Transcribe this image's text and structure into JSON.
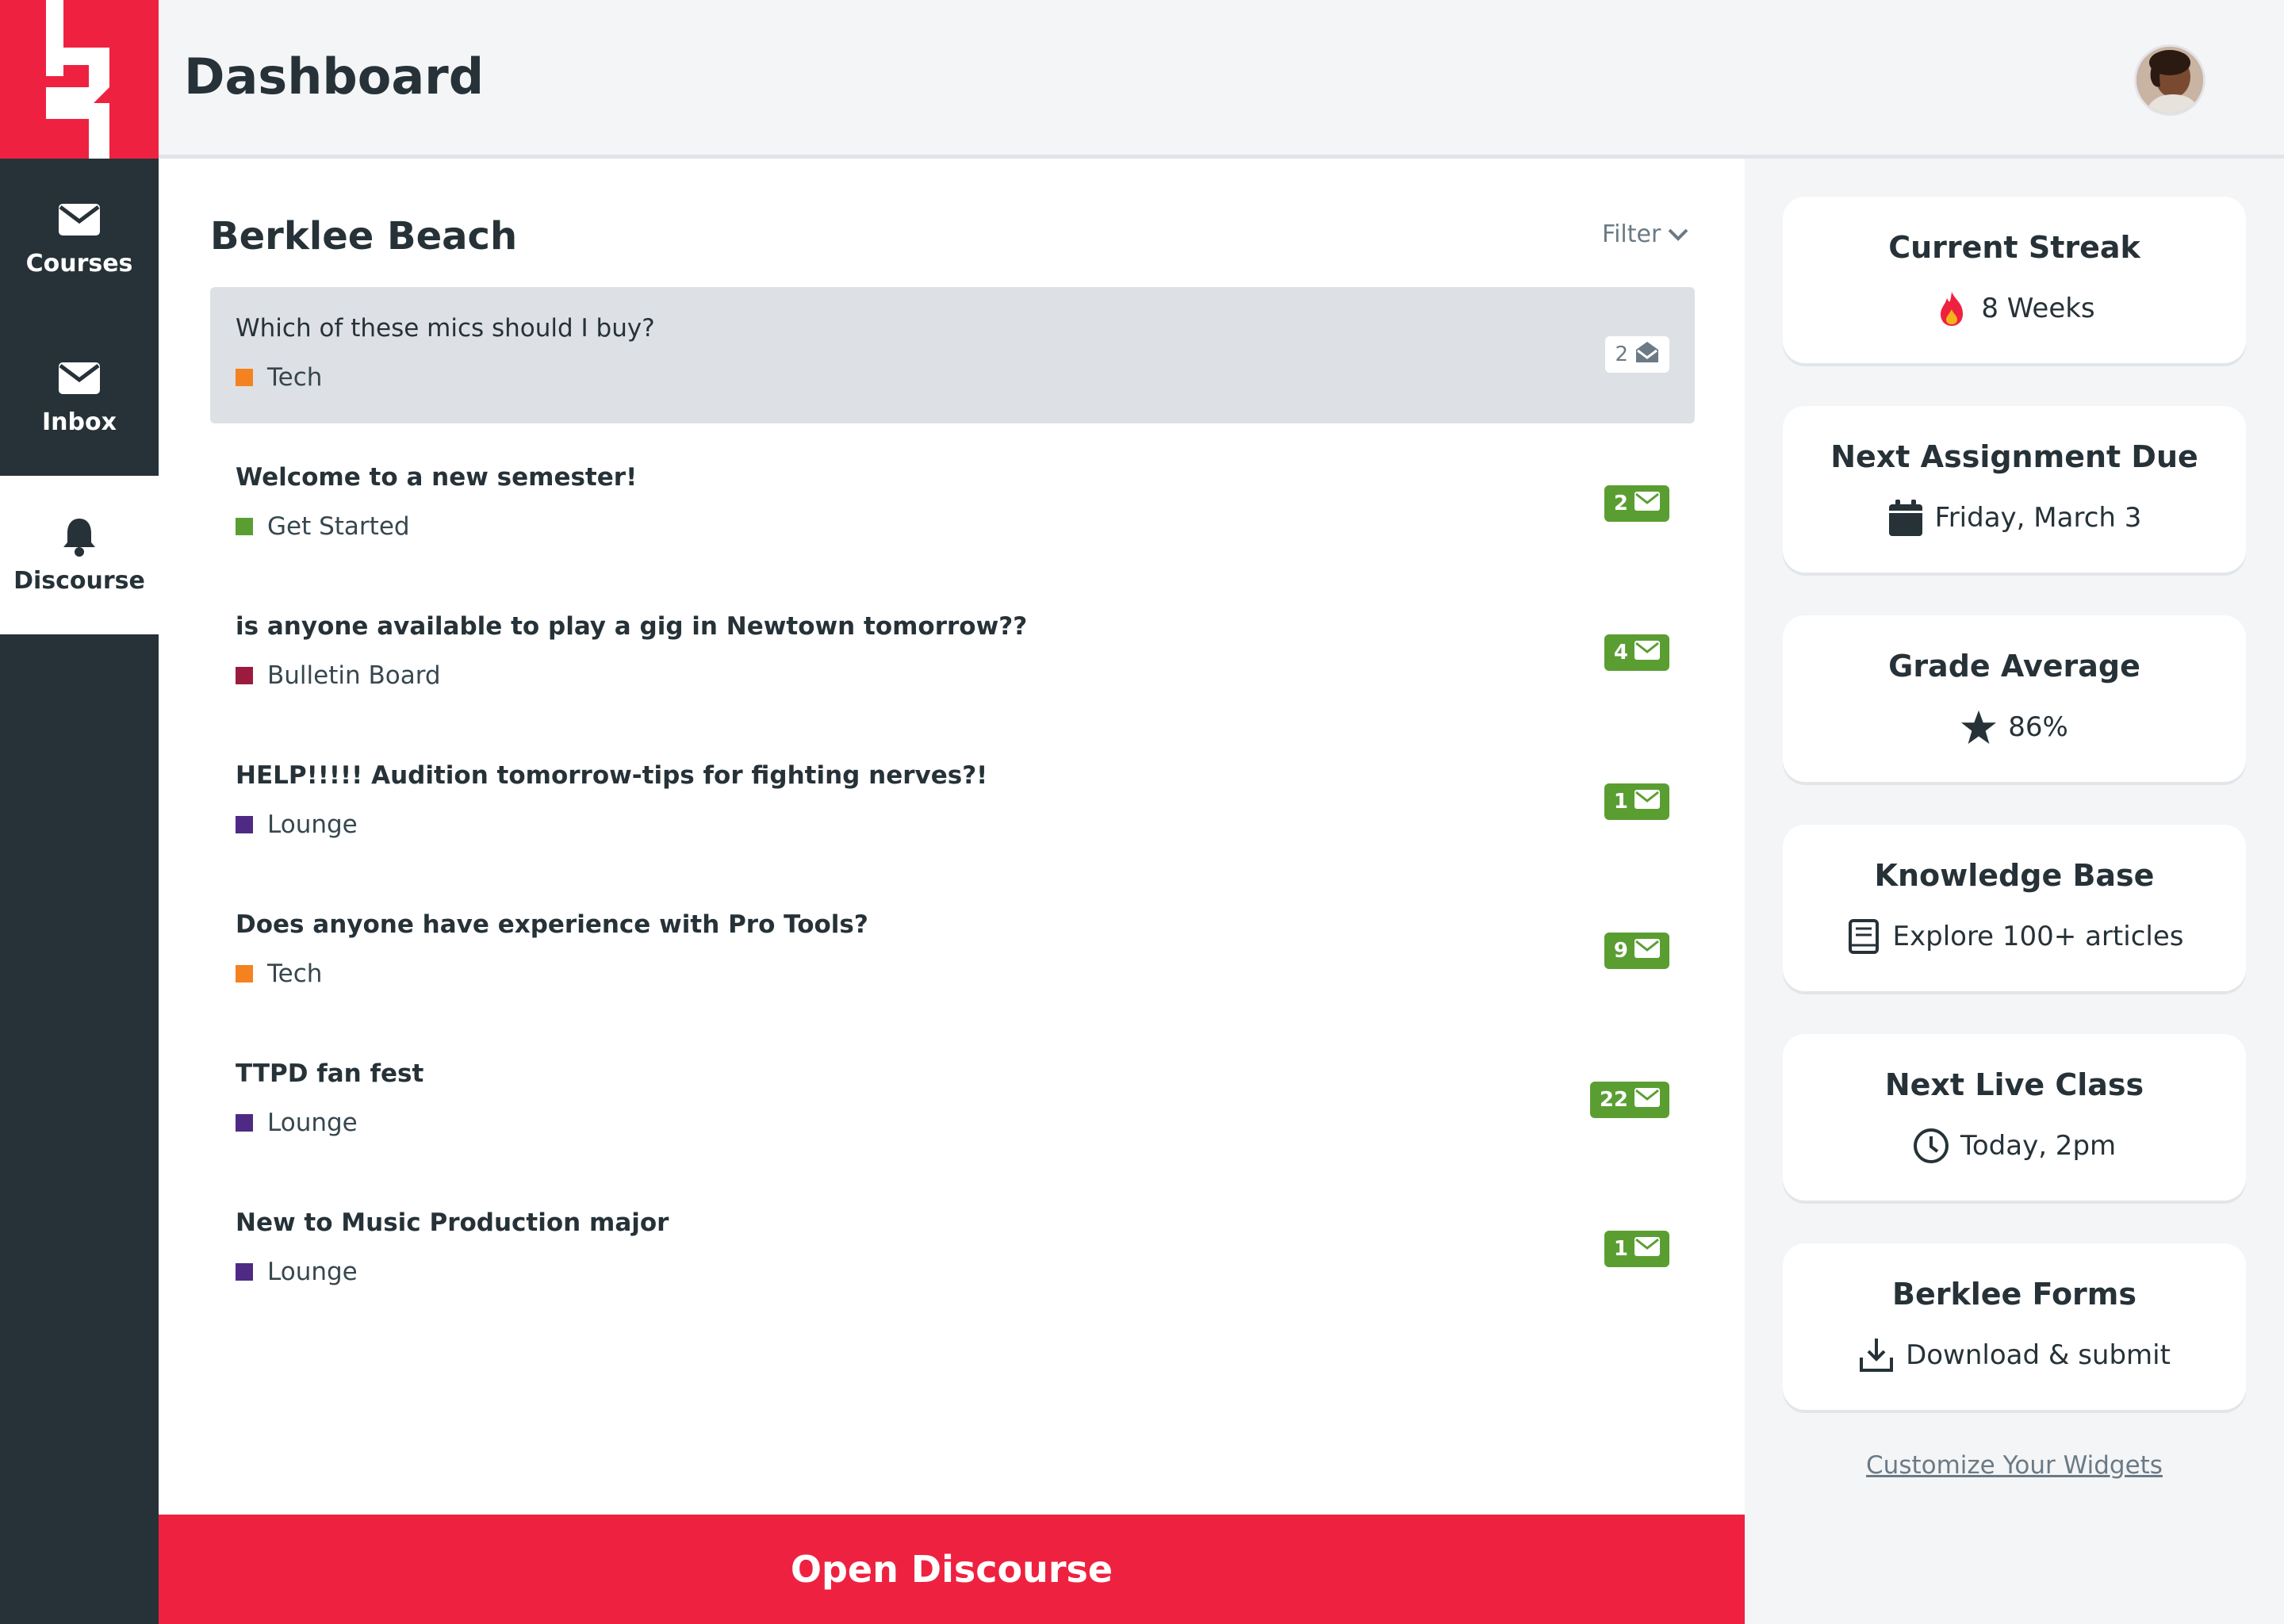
{
  "sidebar": {
    "items": [
      {
        "label": "Courses",
        "icon": "envelope-icon"
      },
      {
        "label": "Inbox",
        "icon": "envelope-icon"
      },
      {
        "label": "Discourse",
        "icon": "bell-icon",
        "active": true
      }
    ]
  },
  "header": {
    "title": "Dashboard"
  },
  "main": {
    "section_title": "Berklee Beach",
    "filter_label": "Filter",
    "topics": [
      {
        "title": "Which of these mics should I buy?",
        "category": "Tech",
        "category_color": "#f58220",
        "replies": "2",
        "read": true
      },
      {
        "title": "Welcome to a new semester!",
        "category": "Get Started",
        "category_color": "#5a9e32",
        "replies": "2",
        "read": false
      },
      {
        "title": "is anyone available to play a gig in Newtown tomorrow??",
        "category": "Bulletin Board",
        "category_color": "#9b1b3f",
        "replies": "4",
        "read": false
      },
      {
        "title": "HELP!!!!! Audition tomorrow-tips for fighting nerves?!",
        "category": "Lounge",
        "category_color": "#4e2a84",
        "replies": "1",
        "read": false
      },
      {
        "title": "Does anyone have experience with Pro Tools?",
        "category": "Tech",
        "category_color": "#f58220",
        "replies": "9",
        "read": false
      },
      {
        "title": "TTPD fan fest",
        "category": "Lounge",
        "category_color": "#4e2a84",
        "replies": "22",
        "read": false
      },
      {
        "title": "New to Music Production major",
        "category": "Lounge",
        "category_color": "#4e2a84",
        "replies": "1",
        "read": false
      }
    ],
    "open_button": "Open Discourse"
  },
  "widgets": [
    {
      "title": "Current Streak",
      "value": "8 Weeks",
      "icon": "fire-icon"
    },
    {
      "title": "Next Assignment Due",
      "value": "Friday, March 3",
      "icon": "calendar-icon"
    },
    {
      "title": "Grade Average",
      "value": "86%",
      "icon": "star-icon"
    },
    {
      "title": "Knowledge Base",
      "value": "Explore 100+ articles",
      "icon": "book-icon"
    },
    {
      "title": "Next Live Class",
      "value": "Today, 2pm",
      "icon": "clock-icon"
    },
    {
      "title": "Berklee Forms",
      "value": "Download & submit",
      "icon": "download-icon"
    }
  ],
  "customize_link": "Customize Your Widgets",
  "colors": {
    "brand_red": "#ee2240",
    "sidebar_dark": "#263238",
    "badge_green": "#5a9e32"
  }
}
